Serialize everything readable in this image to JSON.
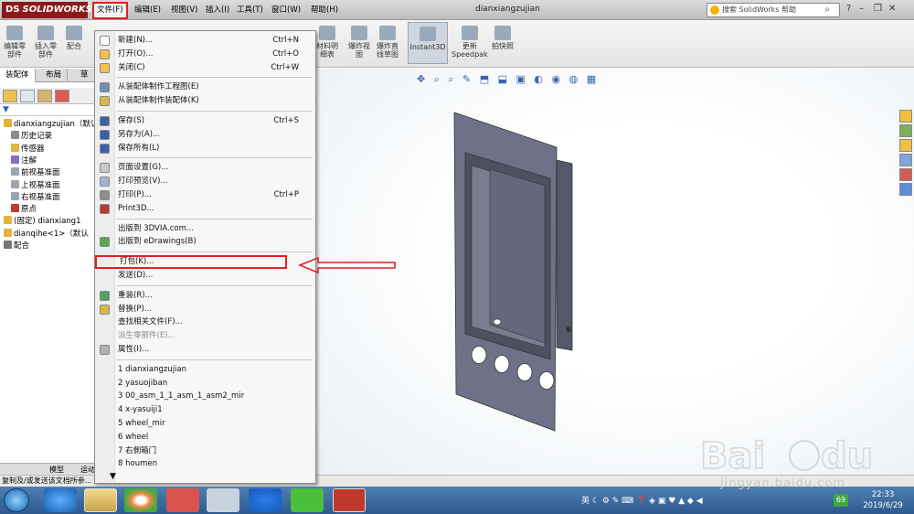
{
  "app": {
    "logo_text": "SOLIDWORKS",
    "logo_mark": "DS",
    "document_title": "dianxiangzujian"
  },
  "menubar": [
    {
      "label": "文件(F)",
      "active": true
    },
    {
      "label": "编辑(E)"
    },
    {
      "label": "视图(V)"
    },
    {
      "label": "插入(I)"
    },
    {
      "label": "工具(T)"
    },
    {
      "label": "窗口(W)"
    },
    {
      "label": "帮助(H)"
    }
  ],
  "search": {
    "placeholder": "搜索 SolidWorks 帮助"
  },
  "command_manager": {
    "left": [
      {
        "label": "编辑零\n部件"
      },
      {
        "label": "插入零\n部件"
      },
      {
        "label": "配合"
      }
    ],
    "right": [
      {
        "label": "材料明\n细表"
      },
      {
        "label": "爆炸视\n图"
      },
      {
        "label": "爆炸直\n线草图"
      },
      {
        "label": "Instant3D",
        "highlighted": true
      },
      {
        "label": "更新\nSpeedpak"
      },
      {
        "label": "拍快照"
      }
    ]
  },
  "panel_tabs": [
    {
      "label": "装配体",
      "selected": true
    },
    {
      "label": "布局"
    },
    {
      "label": "草"
    }
  ],
  "feature_tree": [
    {
      "label": "dianxiangzujian（默认",
      "indent": 0,
      "icon": "assembly-icon"
    },
    {
      "label": "历史记录",
      "indent": 1,
      "icon": "history-icon"
    },
    {
      "label": "传感器",
      "indent": 1,
      "icon": "sensor-icon"
    },
    {
      "label": "注解",
      "indent": 1,
      "icon": "annotation-icon"
    },
    {
      "label": "前视基准面",
      "indent": 1,
      "icon": "plane-icon"
    },
    {
      "label": "上视基准面",
      "indent": 1,
      "icon": "plane-icon"
    },
    {
      "label": "右视基准面",
      "indent": 1,
      "icon": "plane-icon"
    },
    {
      "label": "原点",
      "indent": 1,
      "icon": "origin-icon"
    },
    {
      "label": "(固定) dianxiang1",
      "indent": 0,
      "icon": "part-icon"
    },
    {
      "label": "dianqihe<1>（默认",
      "indent": 0,
      "icon": "part-icon"
    },
    {
      "label": "配合",
      "indent": 0,
      "icon": "mates-icon"
    }
  ],
  "bottom_tabs": [
    "模型",
    "运动"
  ],
  "status_text": "复制及/或发送该文档所参...",
  "file_menu": {
    "items": [
      {
        "label": "新建(N)...",
        "shortcut": "Ctrl+N",
        "icon": "new-icon",
        "color": "#ffffff"
      },
      {
        "label": "打开(O)...",
        "shortcut": "Ctrl+O",
        "icon": "open-icon",
        "color": "#f2c14e"
      },
      {
        "label": "关闭(C)",
        "shortcut": "Ctrl+W",
        "icon": "close-icon",
        "color": "#f2c14e"
      },
      {
        "sep": true
      },
      {
        "label": "从装配体制作工程图(E)",
        "icon": "drawing-icon",
        "color": "#6c8fb7"
      },
      {
        "label": "从装配体制作装配体(K)",
        "icon": "assembly-icon",
        "color": "#d4b84a"
      },
      {
        "sep": true
      },
      {
        "label": "保存(S)",
        "shortcut": "Ctrl+S",
        "icon": "save-icon",
        "color": "#3d5fa8"
      },
      {
        "label": "另存为(A)...",
        "icon": "save-as-icon",
        "color": "#3d5fa8"
      },
      {
        "label": "保存所有(L)",
        "icon": "save-all-icon",
        "color": "#3d5fa8"
      },
      {
        "sep": true
      },
      {
        "label": "页面设置(G)...",
        "icon": "page-setup-icon",
        "color": "#c9c9c9"
      },
      {
        "label": "打印预览(V)...",
        "icon": "print-preview-icon",
        "color": "#9fb4cf"
      },
      {
        "label": "打印(P)...",
        "shortcut": "Ctrl+P",
        "icon": "print-icon",
        "color": "#8d8d8d"
      },
      {
        "label": "Print3D...",
        "icon": "print3d-icon",
        "color": "#c0392b"
      },
      {
        "sep": true
      },
      {
        "label": "出版到 3DVIA.com...",
        "icon": "",
        "color": ""
      },
      {
        "label": "出版到 eDrawings(B)",
        "icon": "edrawings-icon",
        "color": "#5aa845"
      },
      {
        "sep": true
      },
      {
        "label": "打包(K)...",
        "boxed": true,
        "icon": "",
        "color": ""
      },
      {
        "label": "发送(D)...",
        "icon": "",
        "color": ""
      },
      {
        "sep": true
      },
      {
        "label": "重装(R)...",
        "icon": "reload-icon",
        "color": "#4fa35a"
      },
      {
        "label": "替换(P)...",
        "icon": "replace-icon",
        "color": "#d4b84a"
      },
      {
        "label": "查找相关文件(F)...",
        "icon": "",
        "color": ""
      },
      {
        "label": "派生零部件(E)...",
        "disabled": true,
        "icon": "",
        "color": ""
      },
      {
        "label": "属性(I)...",
        "icon": "properties-icon",
        "color": "#b0b0b0"
      },
      {
        "sep": true
      },
      {
        "label": "1 dianxiangzujian"
      },
      {
        "label": "2 yasuojiban"
      },
      {
        "label": "3 00_asm_1_1_asm_1_asm2_mir"
      },
      {
        "label": "4 x-yasuiji1"
      },
      {
        "label": "5 wheel_mir"
      },
      {
        "label": "6 wheel"
      },
      {
        "label": "7 右側箱门"
      },
      {
        "label": "8 houmen"
      }
    ],
    "more_glyph": "▼"
  },
  "taskbar": {
    "tray_text": "英",
    "badge": "69",
    "time": "22:33",
    "date": "2019/6/29"
  },
  "colors": {
    "menu_highlight": "#e02020",
    "model_face": "#6f7286",
    "model_dark": "#4a4c5c"
  },
  "watermark": {
    "text": "jingyan.baidu.com"
  }
}
